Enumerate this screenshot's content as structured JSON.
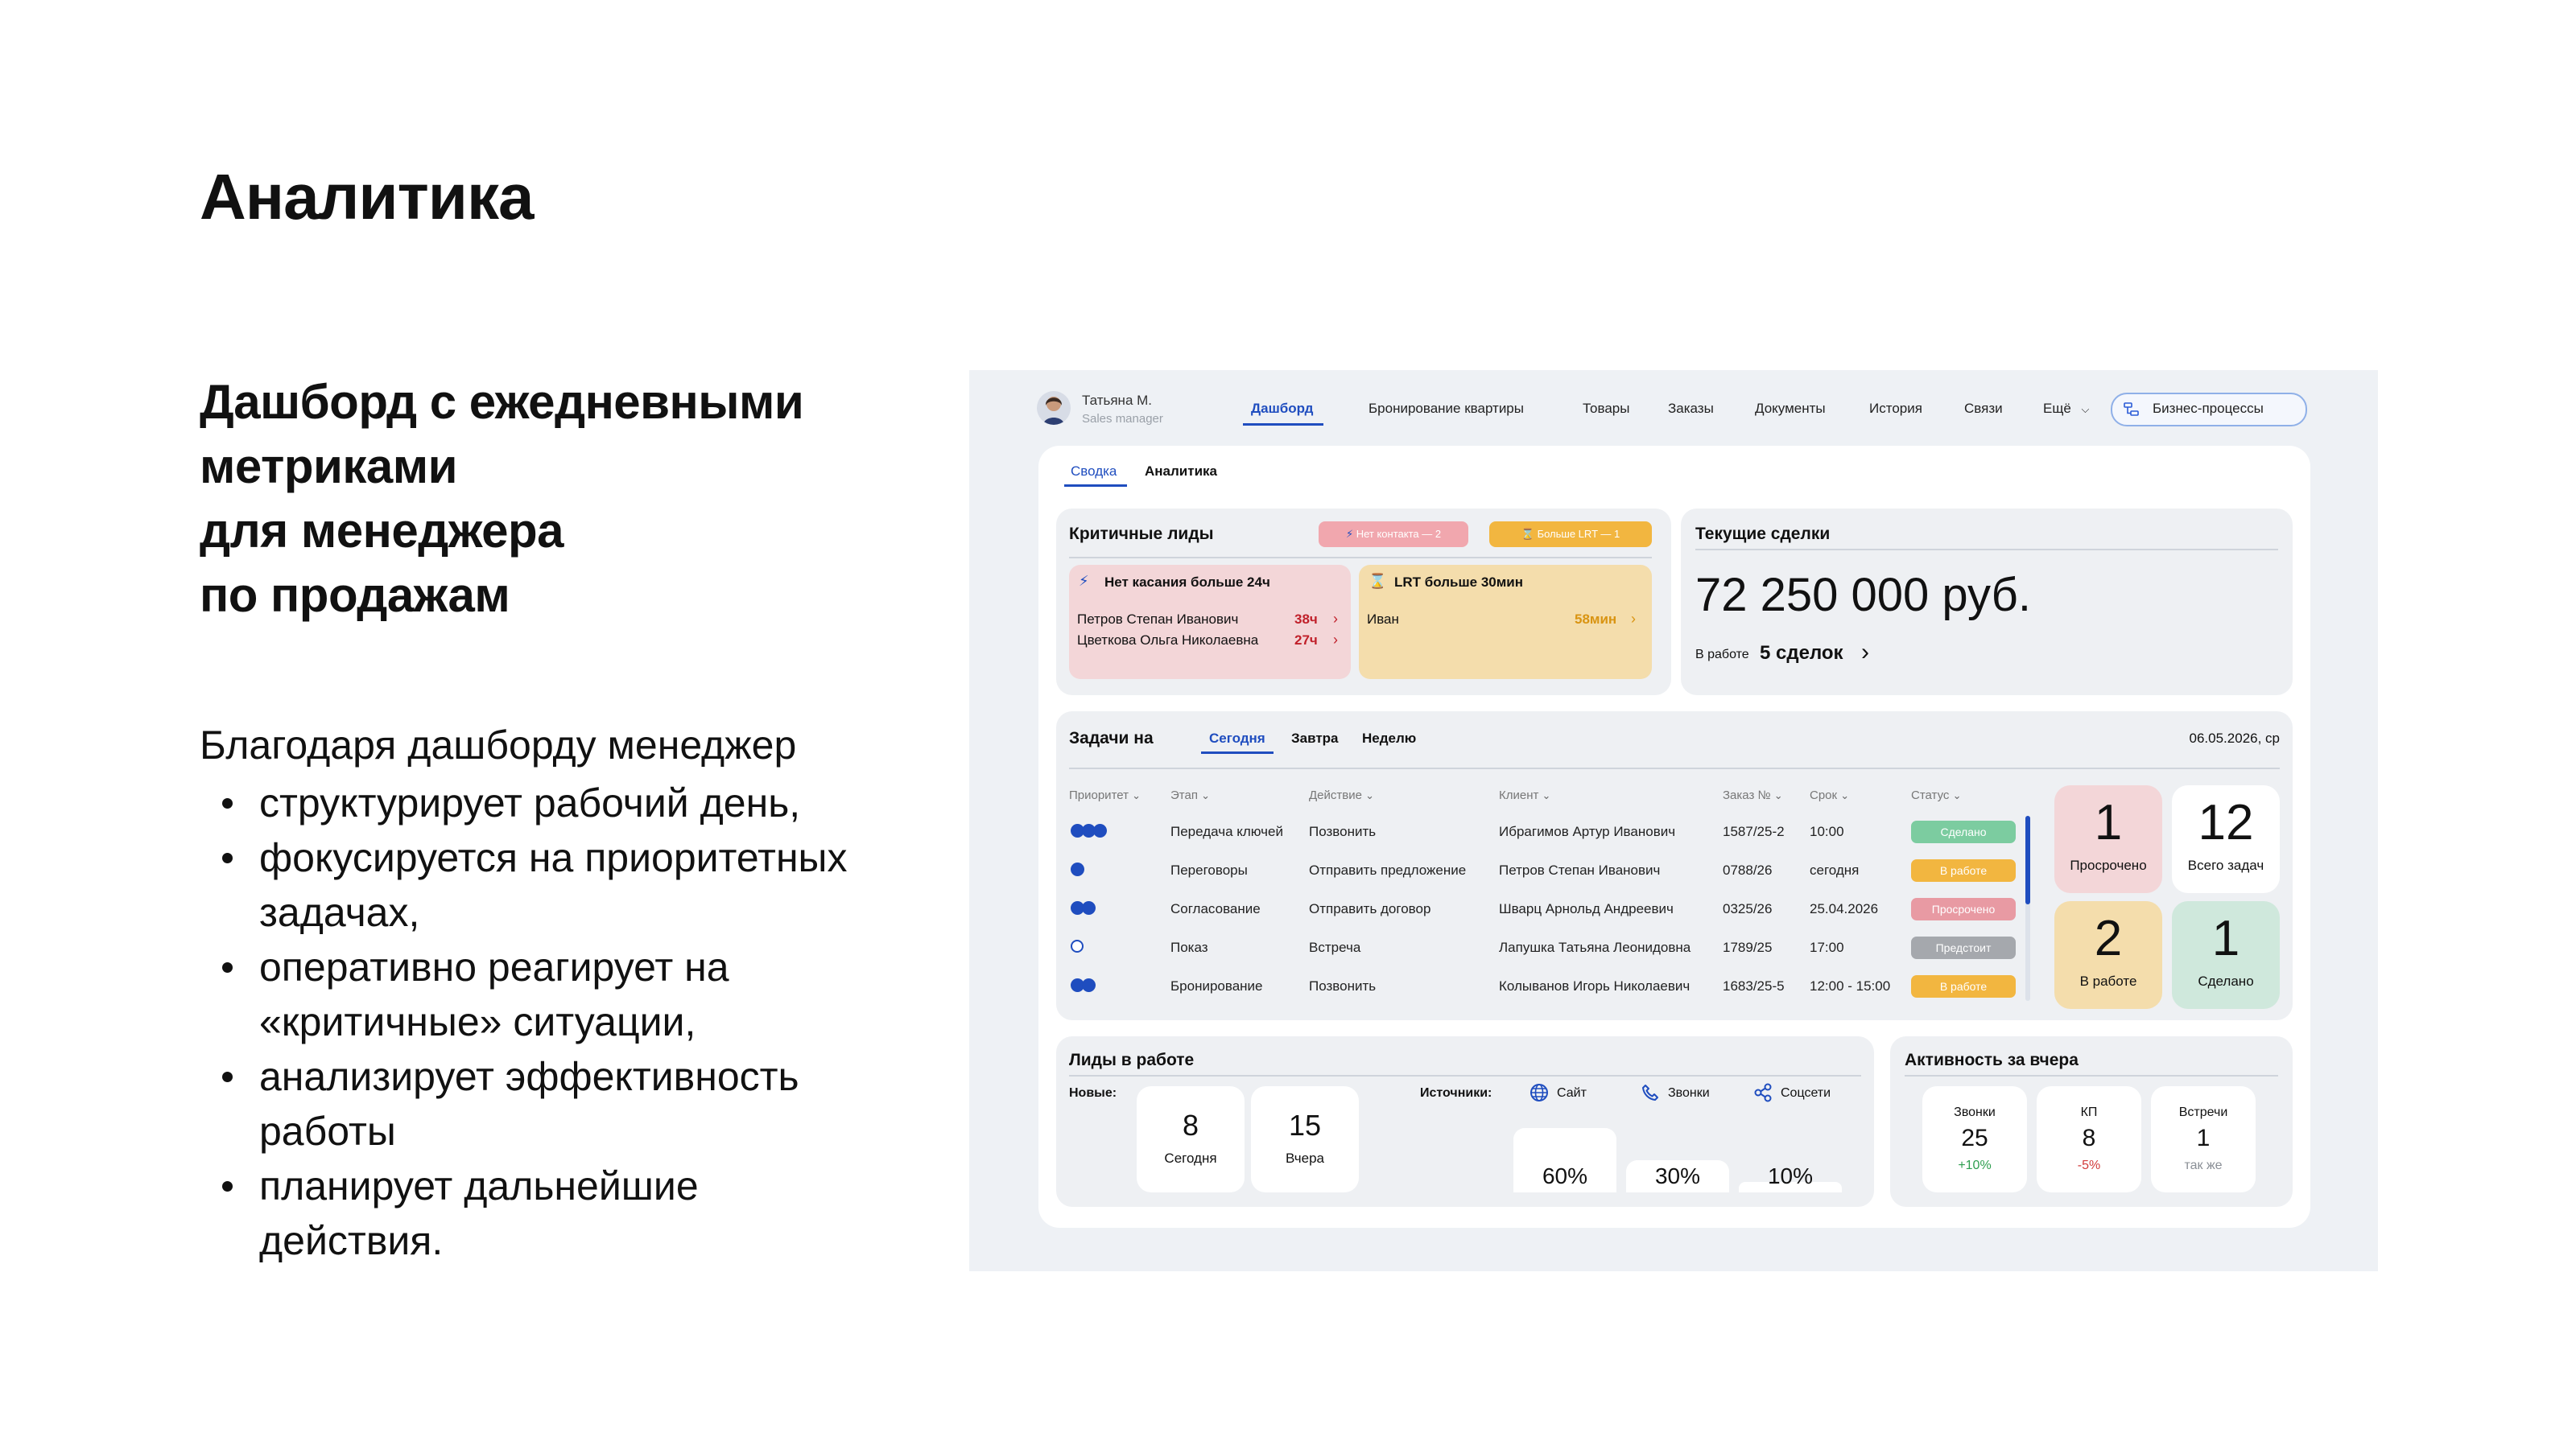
{
  "slide": {
    "title": "Аналитика",
    "subtitle_lines": [
      "Дашборд с ежедневными",
      "метриками",
      "для менеджера",
      "по продажам"
    ],
    "intro": "Благодаря дашборду менеджер",
    "bullets": [
      [
        "структурирует рабочий день,"
      ],
      [
        "фокусируется на приоритетных",
        "задачах,"
      ],
      [
        "оперативно реагирует на",
        "«критичные» ситуации,"
      ],
      [
        "анализирует эффективность",
        "работы"
      ],
      [
        "планирует дальнейшие",
        "действия."
      ]
    ]
  },
  "dashboard": {
    "user": {
      "name": "Татьяна М.",
      "role": "Sales manager"
    },
    "nav": [
      "Дашборд",
      "Бронирование квартиры",
      "Товары",
      "Заказы",
      "Документы",
      "История",
      "Связи",
      "Ещё"
    ],
    "nav_active": "Дашборд",
    "process_button": "Бизнес-процессы",
    "tabs": [
      "Сводка",
      "Аналитика"
    ],
    "critical": {
      "title": "Критичные лиды",
      "badge_no_contact": "Нет контакта — 2",
      "badge_lrt": "Больше LRT — 1",
      "no_touch": {
        "title": "Нет касания больше 24ч",
        "rows": [
          {
            "name": "Петров Степан Иванович",
            "time": "38ч"
          },
          {
            "name": "Цветкова Ольга Николаевна",
            "time": "27ч"
          }
        ]
      },
      "lrt": {
        "title": "LRT больше 30мин",
        "rows": [
          {
            "name": "Иван",
            "time": "58мин"
          }
        ]
      }
    },
    "deals": {
      "title": "Текущие сделки",
      "amount": "72 250 000 руб.",
      "in_work_prefix": "В работе",
      "in_work_count": "5 сделок"
    },
    "tasks": {
      "title": "Задачи на",
      "periods": [
        "Сегодня",
        "Завтра",
        "Неделю"
      ],
      "date": "06.05.2026, ср",
      "columns": [
        "Приоритет",
        "Этап",
        "Действие",
        "Клиент",
        "Заказ №",
        "Срок",
        "Статус"
      ],
      "rows": [
        {
          "priority": 3,
          "stage": "Передача ключей",
          "action": "Позвонить",
          "client": "Ибрагимов Артур Иванович",
          "order": "1587/25-2",
          "due": "10:00",
          "status": "Сделано"
        },
        {
          "priority": 1,
          "stage": "Переговоры",
          "action": "Отправить предложение",
          "client": "Петров Степан Иванович",
          "order": "0788/26",
          "due": "сегодня",
          "status": "В работе"
        },
        {
          "priority": 2,
          "stage": "Согласование",
          "action": "Отправить договор",
          "client": "Шварц Арнольд Андреевич",
          "order": "0325/26",
          "due": "25.04.2026",
          "status": "Просрочено"
        },
        {
          "priority": 0,
          "stage": "Показ",
          "action": "Встреча",
          "client": "Лапушка Татьяна Леонидовна",
          "order": "1789/25",
          "due": "17:00",
          "status": "Предстоит"
        },
        {
          "priority": 2,
          "stage": "Бронирование",
          "action": "Позвонить",
          "client": "Колыванов Игорь Николаевич",
          "order": "1683/25-5",
          "due": "12:00 - 15:00",
          "status": "В работе"
        }
      ],
      "status_colors": {
        "Сделано": "#7ccca0",
        "В работе": "#f2b640",
        "Просрочено": "#e89aa3",
        "Предстоит": "#a5a8ad"
      },
      "summary": [
        {
          "value": "1",
          "label": "Просрочено",
          "color": "#f3d6d8"
        },
        {
          "value": "12",
          "label": "Всего задач",
          "color": "#ffffff"
        },
        {
          "value": "2",
          "label": "В работе",
          "color": "#f4ddac"
        },
        {
          "value": "1",
          "label": "Сделано",
          "color": "#cfe8dc"
        }
      ]
    },
    "leads": {
      "title": "Лиды в работе",
      "new_label": "Новые:",
      "today": {
        "value": "8",
        "label": "Сегодня"
      },
      "yesterday": {
        "value": "15",
        "label": "Вчера"
      },
      "sources_label": "Источники:",
      "sources": [
        {
          "label": "Сайт",
          "icon": "globe-icon",
          "value": "60%",
          "share": 60
        },
        {
          "label": "Звонки",
          "icon": "phone-icon",
          "value": "30%",
          "share": 30
        },
        {
          "label": "Соцсети",
          "icon": "share-icon",
          "value": "10%",
          "share": 10
        }
      ]
    },
    "activity": {
      "title": "Активность за вчера",
      "items": [
        {
          "label": "Звонки",
          "value": "25",
          "delta": "+10%",
          "delta_color": "#2e9e4f"
        },
        {
          "label": "КП",
          "value": "8",
          "delta": "-5%",
          "delta_color": "#d23a3a"
        },
        {
          "label": "Встречи",
          "value": "1",
          "delta": "так же",
          "delta_color": "#8a8f96"
        }
      ]
    }
  }
}
